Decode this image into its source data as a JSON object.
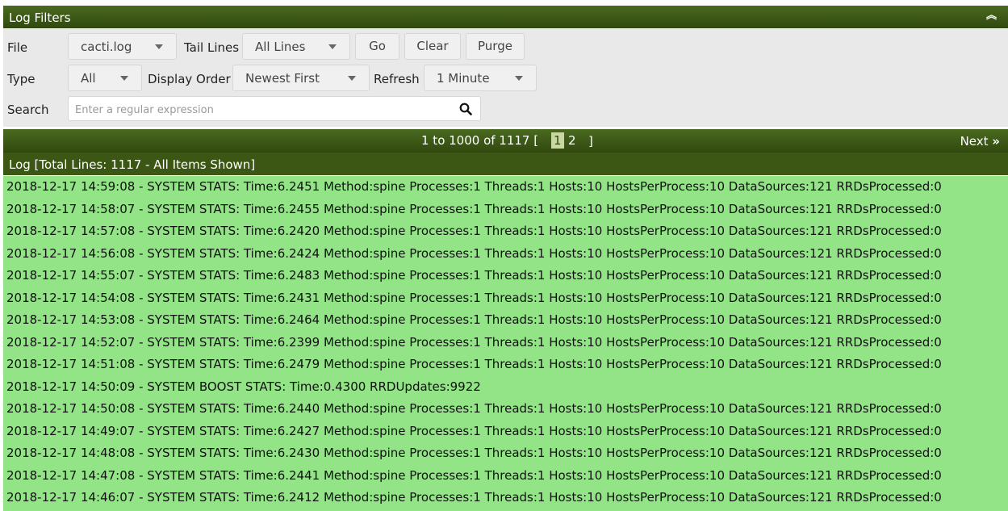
{
  "filters": {
    "title": "Log Filters",
    "collapse_icon": "double-chevron-up-icon",
    "file_label": "File",
    "file_value": "cacti.log",
    "tail_label": "Tail Lines",
    "tail_value": "All Lines",
    "go_label": "Go",
    "clear_label": "Clear",
    "purge_label": "Purge",
    "type_label": "Type",
    "type_value": "All",
    "order_label": "Display Order",
    "order_value": "Newest First",
    "refresh_label": "Refresh",
    "refresh_value": "1 Minute",
    "search_label": "Search",
    "search_placeholder": "Enter a regular expression",
    "search_icon": "magnifier-icon"
  },
  "pager": {
    "range_text": "1 to 1000 of 1117 [",
    "pages": [
      "1",
      "2"
    ],
    "current_page": "1",
    "close_bracket": "]",
    "next_label": "Next",
    "next_icon": "double-chevron-right-icon"
  },
  "log": {
    "title": "Log [Total Lines: 1117 - All Items Shown]",
    "lines": [
      "2018-12-17 14:59:08 - SYSTEM STATS: Time:6.2451 Method:spine Processes:1 Threads:1 Hosts:10 HostsPerProcess:10 DataSources:121 RRDsProcessed:0",
      "2018-12-17 14:58:07 - SYSTEM STATS: Time:6.2455 Method:spine Processes:1 Threads:1 Hosts:10 HostsPerProcess:10 DataSources:121 RRDsProcessed:0",
      "2018-12-17 14:57:08 - SYSTEM STATS: Time:6.2420 Method:spine Processes:1 Threads:1 Hosts:10 HostsPerProcess:10 DataSources:121 RRDsProcessed:0",
      "2018-12-17 14:56:08 - SYSTEM STATS: Time:6.2424 Method:spine Processes:1 Threads:1 Hosts:10 HostsPerProcess:10 DataSources:121 RRDsProcessed:0",
      "2018-12-17 14:55:07 - SYSTEM STATS: Time:6.2483 Method:spine Processes:1 Threads:1 Hosts:10 HostsPerProcess:10 DataSources:121 RRDsProcessed:0",
      "2018-12-17 14:54:08 - SYSTEM STATS: Time:6.2431 Method:spine Processes:1 Threads:1 Hosts:10 HostsPerProcess:10 DataSources:121 RRDsProcessed:0",
      "2018-12-17 14:53:08 - SYSTEM STATS: Time:6.2464 Method:spine Processes:1 Threads:1 Hosts:10 HostsPerProcess:10 DataSources:121 RRDsProcessed:0",
      "2018-12-17 14:52:07 - SYSTEM STATS: Time:6.2399 Method:spine Processes:1 Threads:1 Hosts:10 HostsPerProcess:10 DataSources:121 RRDsProcessed:0",
      "2018-12-17 14:51:08 - SYSTEM STATS: Time:6.2479 Method:spine Processes:1 Threads:1 Hosts:10 HostsPerProcess:10 DataSources:121 RRDsProcessed:0",
      "2018-12-17 14:50:09 - SYSTEM BOOST STATS: Time:0.4300 RRDUpdates:9922",
      "2018-12-17 14:50:08 - SYSTEM STATS: Time:6.2440 Method:spine Processes:1 Threads:1 Hosts:10 HostsPerProcess:10 DataSources:121 RRDsProcessed:0",
      "2018-12-17 14:49:07 - SYSTEM STATS: Time:6.2427 Method:spine Processes:1 Threads:1 Hosts:10 HostsPerProcess:10 DataSources:121 RRDsProcessed:0",
      "2018-12-17 14:48:08 - SYSTEM STATS: Time:6.2430 Method:spine Processes:1 Threads:1 Hosts:10 HostsPerProcess:10 DataSources:121 RRDsProcessed:0",
      "2018-12-17 14:47:08 - SYSTEM STATS: Time:6.2441 Method:spine Processes:1 Threads:1 Hosts:10 HostsPerProcess:10 DataSources:121 RRDsProcessed:0",
      "2018-12-17 14:46:07 - SYSTEM STATS: Time:6.2412 Method:spine Processes:1 Threads:1 Hosts:10 HostsPerProcess:10 DataSources:121 RRDsProcessed:0"
    ]
  },
  "colors": {
    "header_green": "#30480e",
    "log_row_green": "#92e487",
    "filter_bg": "#e9e9e9"
  }
}
